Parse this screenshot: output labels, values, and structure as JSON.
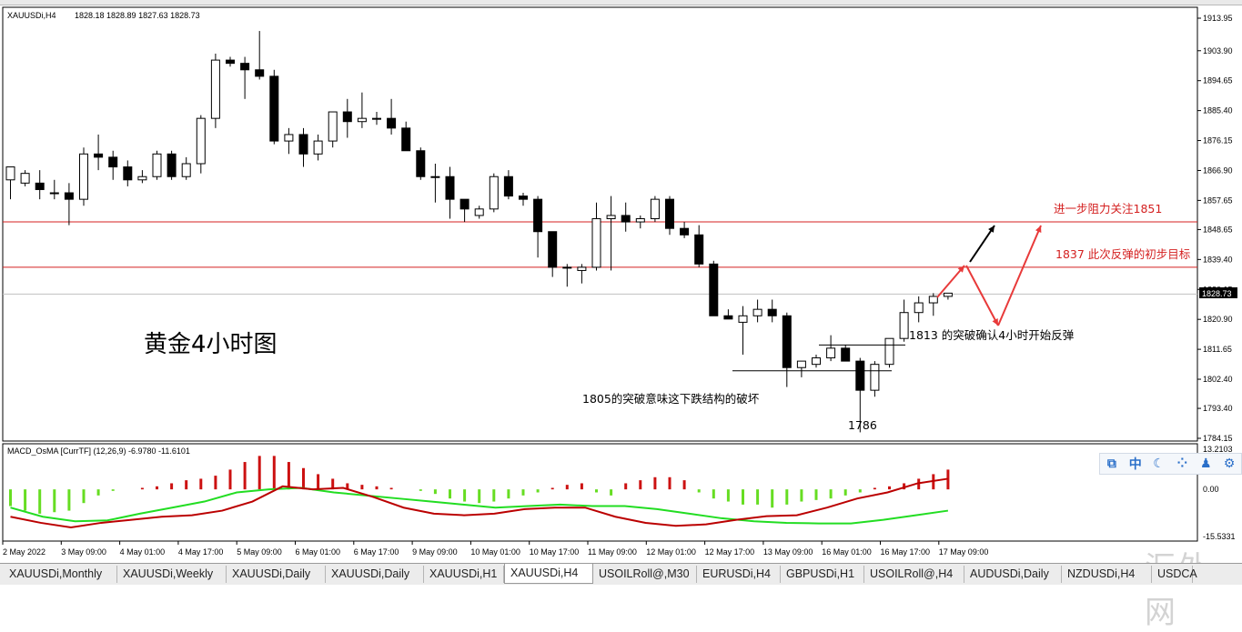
{
  "header": {
    "symbol": "XAUUSDi,H4",
    "ohlc": "1828.18 1828.89 1827.63 1828.73",
    "macd_title": "MACD_OsMA [CurrTF] (12,26,9) -6.9780 -11.6101"
  },
  "price_tag": "1828.73",
  "annotations": {
    "chart_title": "黄金4小时图",
    "resist_1851": "进一步阻力关注1851",
    "target_1837": "1837 此次反弹的初步目标",
    "break_1813": "1813 的突破确认4小时开始反弹",
    "break_1805": "1805的突破意味这下跌结构的破坏",
    "low_1786": "1786"
  },
  "tabs": [
    {
      "label": "XAUUSDi,Monthly",
      "active": false
    },
    {
      "label": "XAUUSDi,Weekly",
      "active": false
    },
    {
      "label": "XAUUSDi,Daily",
      "active": false
    },
    {
      "label": "XAUUSDi,Daily",
      "active": false
    },
    {
      "label": "XAUUSDi,H1",
      "active": false
    },
    {
      "label": "XAUUSDi,H4",
      "active": true
    },
    {
      "label": "USOILRoll@,M30",
      "active": false
    },
    {
      "label": "EURUSDi,H4",
      "active": false
    },
    {
      "label": "GBPUSDi,H1",
      "active": false
    },
    {
      "label": "USOILRoll@,H4",
      "active": false
    },
    {
      "label": "AUDUSDi,Daily",
      "active": false
    },
    {
      "label": "NZDUSDi,H4",
      "active": false
    },
    {
      "label": "USDCA",
      "active": false
    }
  ],
  "toolbar_icons": [
    "chart-icon",
    "language-zh-icon",
    "moon-icon",
    "dots-icon",
    "user-icon",
    "gear-icon"
  ],
  "watermark": "汇外网",
  "colors": {
    "bull": "#ffffff",
    "bear": "#000000",
    "level": "#d42020",
    "hist_up": "#cc1111",
    "hist_down": "#66dd22",
    "macd": "#bb0000",
    "signal": "#22dd22"
  },
  "chart_data": {
    "type": "candlestick",
    "title": "黄金4小时图",
    "symbol": "XAUUSDi",
    "timeframe": "H4",
    "ylim": [
      1784.15,
      1913.95
    ],
    "y_ticks": [
      "1913.95",
      "1903.90",
      "1894.65",
      "1885.40",
      "1876.15",
      "1866.90",
      "1857.65",
      "1848.65",
      "1839.40",
      "1830.15",
      "1820.90",
      "1811.65",
      "1802.40",
      "1793.40",
      "1784.15"
    ],
    "x_ticks": [
      "2 May 2022",
      "3 May 09:00",
      "4 May 01:00",
      "4 May 17:00",
      "5 May 09:00",
      "6 May 01:00",
      "6 May 17:00",
      "9 May 09:00",
      "10 May 01:00",
      "10 May 17:00",
      "11 May 09:00",
      "12 May 01:00",
      "12 May 17:00",
      "13 May 09:00",
      "16 May 01:00",
      "16 May 17:00",
      "17 May 09:00"
    ],
    "horizontal_levels": [
      1851,
      1837
    ],
    "current_price": 1828.73,
    "candles": [
      [
        1864,
        1868,
        1858,
        1868
      ],
      [
        1863,
        1867,
        1862,
        1866
      ],
      [
        1863,
        1867,
        1858,
        1861
      ],
      [
        1860,
        1864,
        1858,
        1860
      ],
      [
        1860,
        1863,
        1850,
        1858
      ],
      [
        1858,
        1874,
        1856,
        1872
      ],
      [
        1872,
        1878,
        1867,
        1871
      ],
      [
        1871,
        1873,
        1864,
        1868
      ],
      [
        1868,
        1870,
        1862,
        1864
      ],
      [
        1864,
        1867,
        1863,
        1865
      ],
      [
        1865,
        1873,
        1864,
        1872
      ],
      [
        1872,
        1873,
        1864,
        1865
      ],
      [
        1865,
        1871,
        1864,
        1869
      ],
      [
        1869,
        1884,
        1866,
        1883
      ],
      [
        1883,
        1903,
        1880,
        1901
      ],
      [
        1901,
        1902,
        1899,
        1900
      ],
      [
        1900,
        1902,
        1889,
        1898
      ],
      [
        1898,
        1910,
        1895,
        1896
      ],
      [
        1896,
        1898,
        1875,
        1876
      ],
      [
        1876,
        1880,
        1872,
        1878
      ],
      [
        1878,
        1880,
        1868,
        1872
      ],
      [
        1872,
        1878,
        1870,
        1876
      ],
      [
        1876,
        1885,
        1874,
        1885
      ],
      [
        1885,
        1889,
        1877,
        1882
      ],
      [
        1882,
        1891,
        1880,
        1883
      ],
      [
        1883,
        1885,
        1881,
        1883
      ],
      [
        1883,
        1889,
        1878,
        1880
      ],
      [
        1880,
        1882,
        1873,
        1873
      ],
      [
        1873,
        1874,
        1864,
        1865
      ],
      [
        1865,
        1869,
        1857,
        1865
      ],
      [
        1865,
        1868,
        1852,
        1858
      ],
      [
        1858,
        1858,
        1851,
        1855
      ],
      [
        1853,
        1856,
        1852,
        1855
      ],
      [
        1855,
        1866,
        1854,
        1865
      ],
      [
        1865,
        1867,
        1858,
        1859
      ],
      [
        1859,
        1860,
        1856,
        1858
      ],
      [
        1858,
        1859,
        1840,
        1848
      ],
      [
        1848,
        1848,
        1834,
        1837
      ],
      [
        1837,
        1838,
        1831,
        1837
      ],
      [
        1836,
        1838,
        1832,
        1837
      ],
      [
        1837,
        1857,
        1836,
        1852
      ],
      [
        1852,
        1859,
        1836,
        1853
      ],
      [
        1853,
        1857,
        1848,
        1851
      ],
      [
        1851,
        1853,
        1849,
        1852
      ],
      [
        1852,
        1859,
        1851,
        1858
      ],
      [
        1858,
        1859,
        1847,
        1849
      ],
      [
        1849,
        1851,
        1846,
        1847
      ],
      [
        1847,
        1850,
        1837,
        1838
      ],
      [
        1838,
        1839,
        1822,
        1822
      ],
      [
        1822,
        1824,
        1821,
        1821
      ],
      [
        1820,
        1825,
        1810,
        1822
      ],
      [
        1822,
        1827,
        1820,
        1824
      ],
      [
        1824,
        1827,
        1820,
        1822
      ],
      [
        1822,
        1823,
        1800,
        1806
      ],
      [
        1806,
        1808,
        1803,
        1808
      ],
      [
        1807,
        1810,
        1806,
        1809
      ],
      [
        1809,
        1816,
        1808,
        1812
      ],
      [
        1812,
        1813,
        1808,
        1808
      ],
      [
        1808,
        1809,
        1786,
        1799
      ],
      [
        1799,
        1808,
        1797,
        1807
      ],
      [
        1807,
        1815,
        1806,
        1815
      ],
      [
        1815,
        1827,
        1814,
        1823
      ],
      [
        1823,
        1828,
        1820,
        1826
      ],
      [
        1826,
        1829,
        1822,
        1828
      ],
      [
        1828,
        1829,
        1827,
        1829
      ]
    ],
    "macd_histogram_range": [
      -15.5,
      13.2
    ],
    "macd_ticks": [
      "13.2103",
      "0.00",
      "-15.5331"
    ],
    "macd_histogram": [
      -5.5,
      -7,
      -8,
      -7.5,
      -7,
      -4.5,
      -2,
      -0.5,
      0,
      0.5,
      1,
      2,
      3,
      3.5,
      4.5,
      6.5,
      9,
      11,
      11,
      9,
      7,
      5,
      3.5,
      2,
      1.5,
      1,
      0.5,
      0,
      -0.5,
      -1.5,
      -3,
      -4,
      -4.5,
      -4,
      -3,
      -2,
      -1,
      0.5,
      1.5,
      2,
      -1,
      -2,
      2,
      3,
      4,
      4,
      3,
      -1,
      -3,
      -4,
      -5,
      -5,
      -6,
      -5,
      -4,
      -3.5,
      -3,
      -2,
      -1,
      0.5,
      1,
      2,
      3.5,
      5,
      6.5
    ],
    "macd_line": [
      -9,
      -11,
      -12.5,
      -11,
      -10,
      -9,
      -8.5,
      -7,
      -4,
      1,
      0,
      0.5,
      -2.5,
      -6,
      -8,
      -8.5,
      -8,
      -6.5,
      -6,
      -6,
      -9,
      -11,
      -12,
      -11.5,
      -10,
      -8.8,
      -8.5,
      -6,
      -3,
      -1,
      2,
      3.5
    ],
    "signal_line": [
      -6,
      -9,
      -10.5,
      -10.2,
      -8,
      -6,
      -4,
      -1,
      0,
      0.5,
      -1,
      -2,
      -3,
      -4,
      -5,
      -6,
      -5.5,
      -5,
      -5.5,
      -5.5,
      -6.5,
      -8,
      -9.5,
      -10.5,
      -11,
      -11.2,
      -11.2,
      -10,
      -8.5,
      -7
    ]
  }
}
